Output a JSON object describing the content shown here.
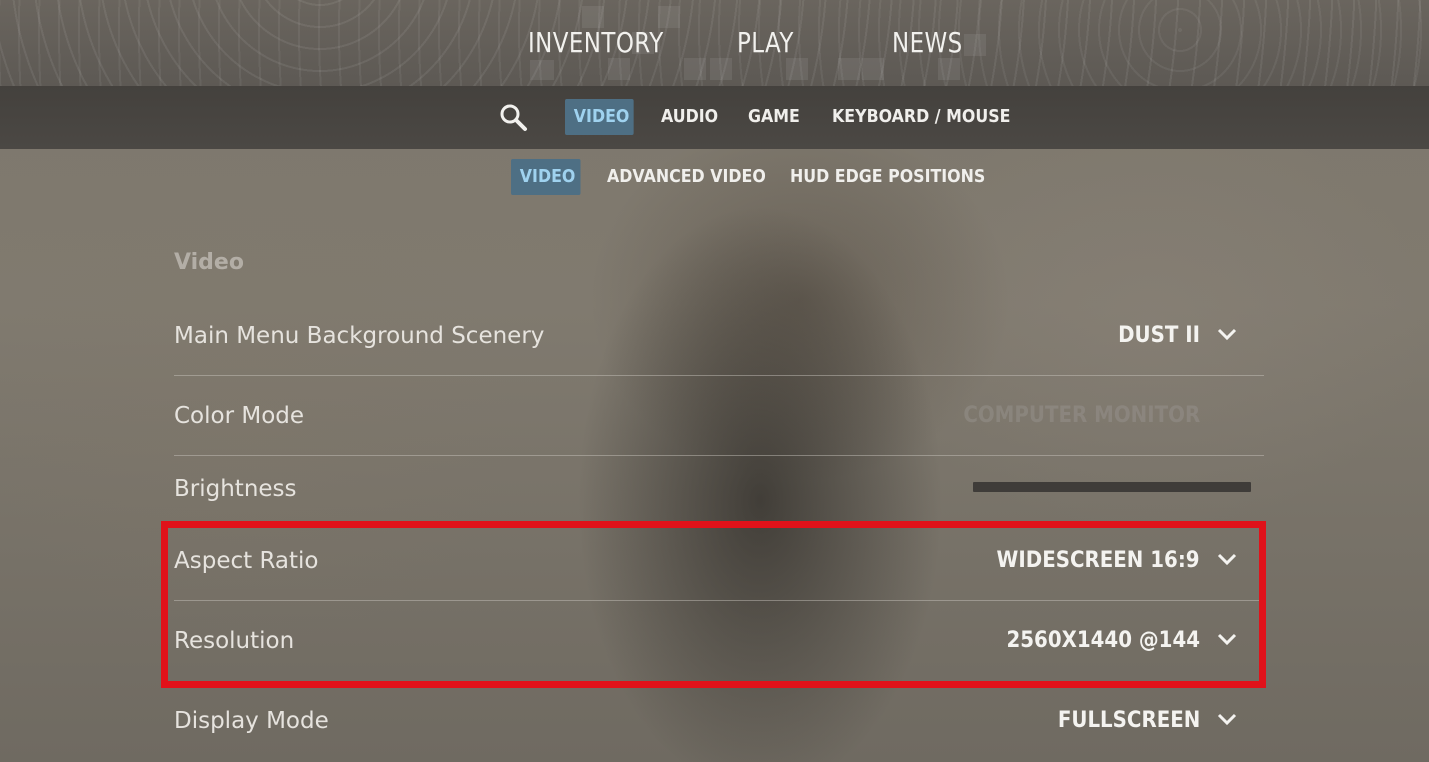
{
  "top_nav": {
    "tabs": [
      {
        "label": "INVENTORY"
      },
      {
        "label": "PLAY"
      },
      {
        "label": "NEWS"
      }
    ]
  },
  "settings_tabs": {
    "search_icon": "magnifier-icon",
    "items": [
      {
        "label": "VIDEO",
        "active": true
      },
      {
        "label": "AUDIO",
        "active": false
      },
      {
        "label": "GAME",
        "active": false
      },
      {
        "label": "KEYBOARD / MOUSE",
        "active": false
      }
    ]
  },
  "sub_tabs": {
    "items": [
      {
        "label": "VIDEO",
        "active": true
      },
      {
        "label": "ADVANCED VIDEO",
        "active": false
      },
      {
        "label": "HUD EDGE POSITIONS",
        "active": false
      }
    ]
  },
  "section": {
    "title": "Video",
    "rows": [
      {
        "label": "Main Menu Background Scenery",
        "value": "DUST II",
        "control": "dropdown"
      },
      {
        "label": "Color Mode",
        "value": "COMPUTER MONITOR",
        "control": "dropdown-disabled"
      },
      {
        "label": "Brightness",
        "value": "",
        "control": "slider"
      },
      {
        "label": "Aspect Ratio",
        "value": "WIDESCREEN 16:9",
        "control": "dropdown"
      },
      {
        "label": "Resolution",
        "value": "2560X1440 @144",
        "control": "dropdown"
      },
      {
        "label": "Display Mode",
        "value": "FULLSCREEN",
        "control": "dropdown"
      }
    ]
  },
  "colors": {
    "active_tab_bg": "#4e6f84",
    "active_tab_text": "#9fd2ef",
    "highlight": "#e0121a"
  }
}
